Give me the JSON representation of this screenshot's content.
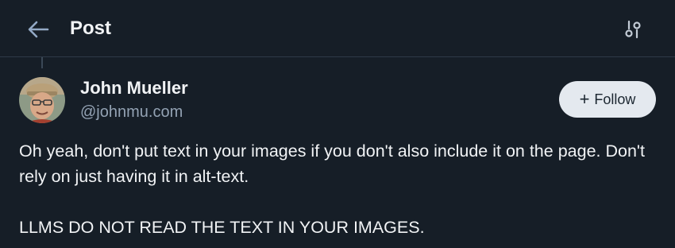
{
  "header": {
    "back_icon": "arrow-left-icon",
    "title": "Post",
    "settings_icon": "sliders-icon"
  },
  "post": {
    "author_name": "John Mueller",
    "author_handle": "@johnmu.com",
    "follow_label": "Follow",
    "follow_icon": "plus-icon",
    "paragraphs": [
      "Oh yeah, don't put text in your images if you don't also include it on the page. Don't rely on just having it in alt-text.",
      "LLMS DO NOT READ THE TEXT IN YOUR IMAGES."
    ]
  },
  "colors": {
    "background": "#161e27",
    "divider": "#2e3a47",
    "text_primary": "#f1f3f5",
    "text_secondary": "#93a2b3",
    "follow_button_bg": "#e4e9ef"
  }
}
